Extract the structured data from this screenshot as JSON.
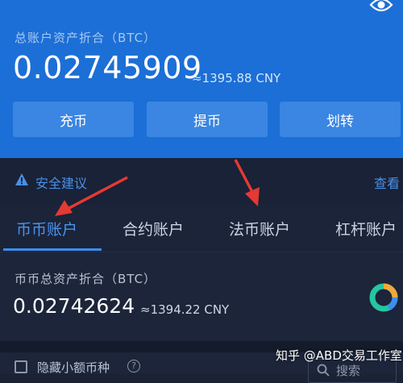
{
  "header": {
    "total_label": "总账户资产折合（BTC）",
    "total_btc": "0.02745909",
    "total_cny": "≈1395.88 CNY",
    "actions": [
      {
        "label": "充币"
      },
      {
        "label": "提币"
      },
      {
        "label": "划转"
      }
    ]
  },
  "safety": {
    "label": "安全建议",
    "view": "查看"
  },
  "tabs": [
    {
      "label": "币币账户",
      "active": true
    },
    {
      "label": "合约账户",
      "active": false
    },
    {
      "label": "法币账户",
      "active": false
    },
    {
      "label": "杠杆账户",
      "active": false
    }
  ],
  "asset": {
    "label": "币币总资产折合（BTC）",
    "btc": "0.02742624",
    "cny": "≈1394.22 CNY"
  },
  "filter": {
    "hide_small_label": "隐藏小额币种",
    "help": "?",
    "search_placeholder": "搜索"
  },
  "watermark": "知乎 @ABD交易工作室",
  "colors": {
    "header_bg": "#1c6fd6",
    "accent": "#4a93ee",
    "annotation_arrow": "#e53935"
  }
}
